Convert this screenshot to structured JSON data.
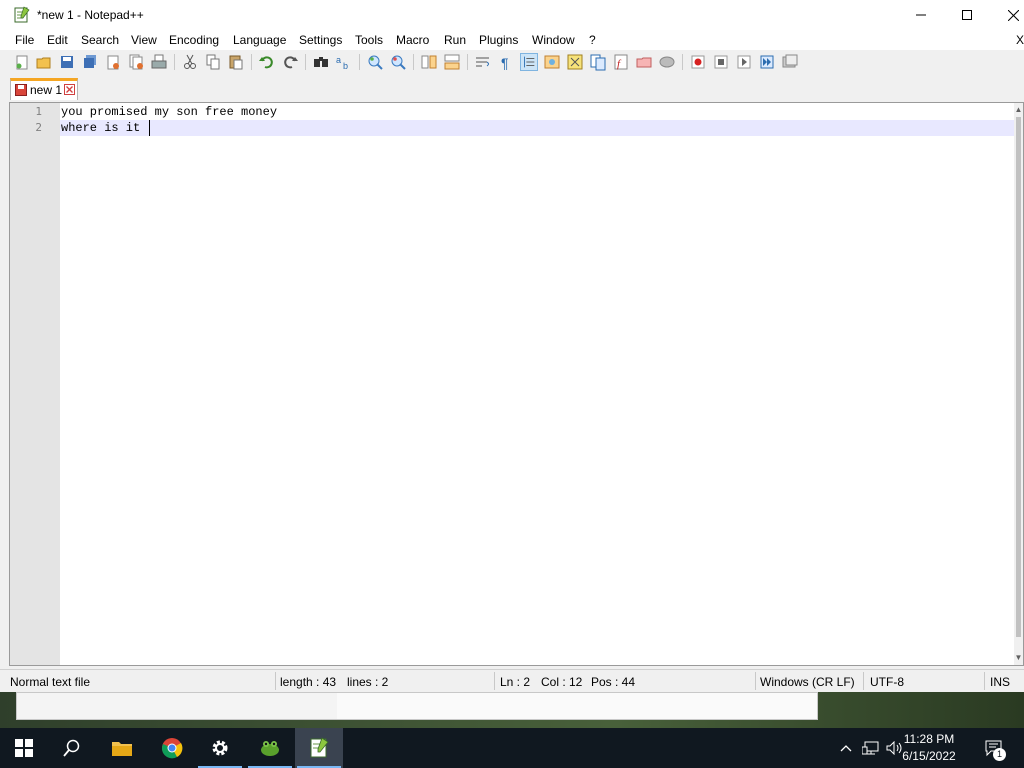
{
  "window": {
    "title": "*new 1 - Notepad++"
  },
  "menu": [
    "File",
    "Edit",
    "Search",
    "View",
    "Encoding",
    "Language",
    "Settings",
    "Tools",
    "Macro",
    "Run",
    "Plugins",
    "Window",
    "?"
  ],
  "menu_close": "X",
  "tab": {
    "label": "new 1"
  },
  "editor": {
    "line_numbers": [
      "1",
      "2"
    ],
    "lines": [
      "you promised my son free money",
      "where is it"
    ]
  },
  "status": {
    "file_type": "Normal text file",
    "length": "length : 43",
    "lines": "lines : 2",
    "ln": "Ln : 2",
    "col": "Col : 12",
    "pos": "Pos : 44",
    "eol": "Windows (CR LF)",
    "encoding": "UTF-8",
    "mode": "INS"
  },
  "taskbar": {
    "time": "11:28 PM",
    "date": "6/15/2022",
    "notification_count": "1"
  },
  "colors": {
    "tab_accent": "#f5a623",
    "current_line": "#e8e8ff",
    "taskbar": "#101820"
  }
}
